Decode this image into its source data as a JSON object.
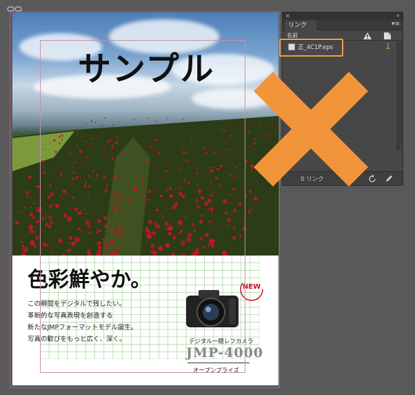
{
  "document": {
    "photo_title": "サンプル",
    "headline": "色彩鮮やか。",
    "body_lines": [
      "この瞬間をデジタルで残したい。",
      "革新的な写真表現を創造する",
      "新たなJMPフォーマットモデル誕生。",
      "写真の歓びをもっと広く、深く。"
    ],
    "badge": "NEW",
    "camera_caption": "デジタル一眼レフカメラ",
    "camera_model": "JMP-4000",
    "camera_price": "オープンプライズ"
  },
  "links_panel": {
    "tab_label": "リンク",
    "column_name": "名前",
    "items": [
      {
        "name": "正_4C1P.eps",
        "page": "1"
      }
    ],
    "footer_text": "0 リンク",
    "menu_icon": "panel-menu-icon",
    "status_icon": "warning-icon",
    "page_icon": "page-icon"
  },
  "colors": {
    "accent_orange": "#f2953a",
    "panel_bg": "#474747",
    "flower_red": "#c8161e"
  }
}
